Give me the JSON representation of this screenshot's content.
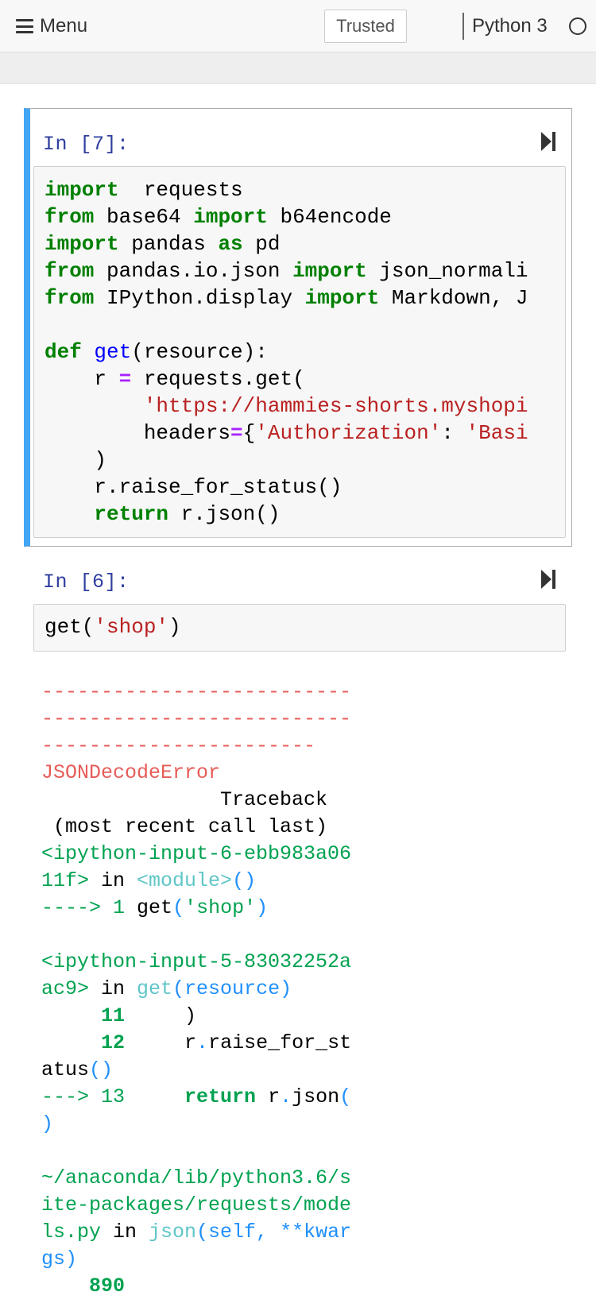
{
  "header": {
    "menu_label": "Menu",
    "trusted_label": "Trusted",
    "kernel_name": "Python 3"
  },
  "cells": [
    {
      "prompt": "In [7]:",
      "code_lines": [
        [
          [
            "k",
            "import"
          ],
          [
            "",
            "  requests"
          ]
        ],
        [
          [
            "k",
            "from"
          ],
          [
            "",
            " base64 "
          ],
          [
            "k",
            "import"
          ],
          [
            "",
            " b64encode"
          ]
        ],
        [
          [
            "k",
            "import"
          ],
          [
            "",
            " pandas "
          ],
          [
            "k",
            "as"
          ],
          [
            "",
            " pd"
          ]
        ],
        [
          [
            "k",
            "from"
          ],
          [
            "",
            " pandas.io.json "
          ],
          [
            "k",
            "import"
          ],
          [
            "",
            " json_normali"
          ]
        ],
        [
          [
            "k",
            "from"
          ],
          [
            "",
            " IPython.display "
          ],
          [
            "k",
            "import"
          ],
          [
            "",
            " Markdown, J"
          ]
        ],
        [
          [
            "",
            ""
          ]
        ],
        [
          [
            "k",
            "def"
          ],
          [
            "",
            " "
          ],
          [
            "f",
            "get"
          ],
          [
            "",
            "(resource):"
          ]
        ],
        [
          [
            "",
            "    r "
          ],
          [
            "o",
            "="
          ],
          [
            "",
            " requests.get("
          ]
        ],
        [
          [
            "",
            "        "
          ],
          [
            "s",
            "'https://hammies-shorts.myshopi"
          ]
        ],
        [
          [
            "",
            "        headers"
          ],
          [
            "o",
            "="
          ],
          [
            "",
            "{"
          ],
          [
            "s",
            "'Authorization'"
          ],
          [
            "",
            ": "
          ],
          [
            "s",
            "'Basi"
          ]
        ],
        [
          [
            "",
            "    )"
          ]
        ],
        [
          [
            "",
            "    r.raise_for_status()"
          ]
        ],
        [
          [
            "",
            "    "
          ],
          [
            "k",
            "return"
          ],
          [
            "",
            " r.json()"
          ]
        ]
      ]
    },
    {
      "prompt": "In [6]:",
      "code_lines": [
        [
          [
            "",
            "get("
          ],
          [
            "s",
            "'shop'"
          ],
          [
            "",
            ")"
          ]
        ]
      ]
    }
  ],
  "output": {
    "lines": [
      [
        [
          "red",
          "--------------------------"
        ]
      ],
      [
        [
          "red",
          "--------------------------"
        ]
      ],
      [
        [
          "red",
          "-----------------------"
        ]
      ],
      [
        [
          "red",
          "JSONDecodeError"
        ]
      ],
      [
        [
          "bk",
          "               Traceback"
        ]
      ],
      [
        [
          "bk",
          " (most recent call last)"
        ]
      ],
      [
        [
          "grn",
          "<ipython-input-6-ebb983a06"
        ]
      ],
      [
        [
          "grn",
          "11f>"
        ],
        [
          "bk",
          " in "
        ],
        [
          "cy",
          "<module>"
        ],
        [
          "bl",
          "()"
        ]
      ],
      [
        [
          "grn",
          "----> 1 "
        ],
        [
          "bk",
          "get"
        ],
        [
          "bl",
          "("
        ],
        [
          "grn",
          "'shop'"
        ],
        [
          "bl",
          ")"
        ]
      ],
      [
        [
          "",
          ""
        ]
      ],
      [
        [
          "grn",
          "<ipython-input-5-83032252a"
        ]
      ],
      [
        [
          "grn",
          "ac9>"
        ],
        [
          "bk",
          " in "
        ],
        [
          "cy",
          "get"
        ],
        [
          "bl",
          "(resource)"
        ]
      ],
      [
        [
          "gb",
          "     11"
        ],
        [
          "bk",
          "     )"
        ]
      ],
      [
        [
          "gb",
          "     12"
        ],
        [
          "bk",
          "     r"
        ],
        [
          "bl",
          "."
        ],
        [
          "bk",
          "raise_for_st"
        ]
      ],
      [
        [
          "bk",
          "atus"
        ],
        [
          "bl",
          "()"
        ]
      ],
      [
        [
          "grn",
          "---> 13"
        ],
        [
          "bk",
          "     "
        ],
        [
          "gb",
          "return"
        ],
        [
          "bk",
          " r"
        ],
        [
          "bl",
          "."
        ],
        [
          "bk",
          "json"
        ],
        [
          "bl",
          "("
        ]
      ],
      [
        [
          "bl",
          ")"
        ]
      ],
      [
        [
          "",
          ""
        ]
      ],
      [
        [
          "grn",
          "~/anaconda/lib/python3.6/s"
        ]
      ],
      [
        [
          "grn",
          "ite-packages/requests/mode"
        ]
      ],
      [
        [
          "grn",
          "ls.py"
        ],
        [
          "bk",
          " in "
        ],
        [
          "cy",
          "json"
        ],
        [
          "bl",
          "(self, **kwar"
        ]
      ],
      [
        [
          "bl",
          "gs)"
        ]
      ],
      [
        [
          "gb",
          "    890"
        ]
      ]
    ]
  },
  "icons": {
    "run_cell": "skip-to-end-icon",
    "menu": "hamburger-icon",
    "kernel_status": "kernel-idle-circle-icon"
  }
}
